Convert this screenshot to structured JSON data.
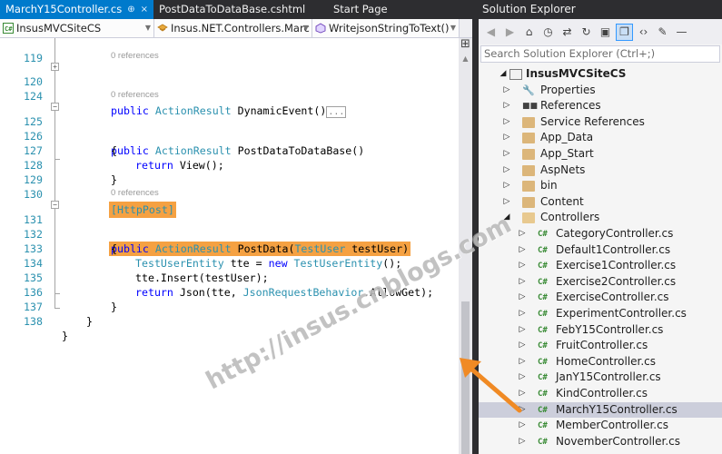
{
  "tabs": [
    {
      "label": "MarchY15Controller.cs",
      "pin": "⊕",
      "close": "×",
      "active": true
    },
    {
      "label": "PostDataToDataBase.cshtml",
      "active": false
    },
    {
      "label": "Start Page",
      "active": false
    }
  ],
  "navbar": {
    "project": "InsusMVCSiteCS",
    "type": "Insus.NET.Controllers.Marc",
    "member": "WritejsonStringToText()"
  },
  "code": {
    "line_numbers": [
      "119",
      "120",
      "124",
      "125",
      "126",
      "127",
      "128",
      "129",
      "130",
      "131",
      "132",
      "133",
      "134",
      "135",
      "136",
      "137",
      "138"
    ],
    "refs": "0 references",
    "lines": {
      "l120": {
        "kw1": "public",
        "ty1": "ActionResult",
        "rest": " DynamicEvent()",
        "ellipsis": "..."
      },
      "l125": {
        "kw1": "public",
        "ty1": "ActionResult",
        "rest": " PostDataToDataBase()"
      },
      "l126": "{",
      "l127": {
        "kw1": "return",
        "rest": " View();"
      },
      "l128": "}",
      "l130": "[HttpPost]",
      "l131": {
        "kw1": "public",
        "ty1": "ActionResult",
        "mid": " PostData(",
        "ty2": "TestUser",
        "rest": " testUser)"
      },
      "l132": "{",
      "l133": {
        "ty1": "TestUserEntity",
        "mid": " tte = ",
        "kw1": "new",
        "ty2": "TestUserEntity",
        "rest": "();"
      },
      "l134": "tte.Insert(testUser);",
      "l135": {
        "kw1": "return",
        "mid": " Json(tte, ",
        "ty1": "JsonRequestBehavior",
        "rest": ".AllowGet);"
      },
      "l136": "}",
      "l137": "}",
      "l138": "}"
    }
  },
  "solution_explorer": {
    "title": "Solution Explorer",
    "search_placeholder": "Search Solution Explorer (Ctrl+;)",
    "toolbar_icons": [
      "back-icon",
      "forward-icon",
      "home-icon",
      "history-icon",
      "sync-icon",
      "refresh-icon",
      "collapse-icon",
      "show-all-files-icon",
      "code-view-icon",
      "properties-wrench-icon",
      "pin-icon"
    ],
    "project": "InsusMVCSiteCS",
    "items": [
      {
        "label": "Properties",
        "icon": "wrench-icon"
      },
      {
        "label": "References",
        "icon": "references-icon"
      },
      {
        "label": "Service References",
        "icon": "folder-icon"
      },
      {
        "label": "App_Data",
        "icon": "folder-icon"
      },
      {
        "label": "App_Start",
        "icon": "folder-icon"
      },
      {
        "label": "AspNets",
        "icon": "folder-icon"
      },
      {
        "label": "bin",
        "icon": "folder-icon"
      },
      {
        "label": "Content",
        "icon": "folder-icon"
      },
      {
        "label": "Controllers",
        "icon": "folder-open-icon"
      }
    ],
    "controllers": [
      "CategoryController.cs",
      "Default1Controller.cs",
      "Exercise1Controller.cs",
      "Exercise2Controller.cs",
      "ExerciseController.cs",
      "ExperimentController.cs",
      "FebY15Controller.cs",
      "FruitController.cs",
      "HomeController.cs",
      "JanY15Controller.cs",
      "KindController.cs",
      "MarchY15Controller.cs",
      "MemberController.cs",
      "NovemberController.cs"
    ],
    "selected": "MarchY15Controller.cs",
    "cs_glyph": "C#"
  },
  "watermark": "http://insus.cnblogs.com",
  "colors": {
    "accent": "#007acc",
    "highlight": "#f5a142",
    "arrow": "#f08a24",
    "keyword": "#0000ff",
    "type": "#2b91af"
  }
}
